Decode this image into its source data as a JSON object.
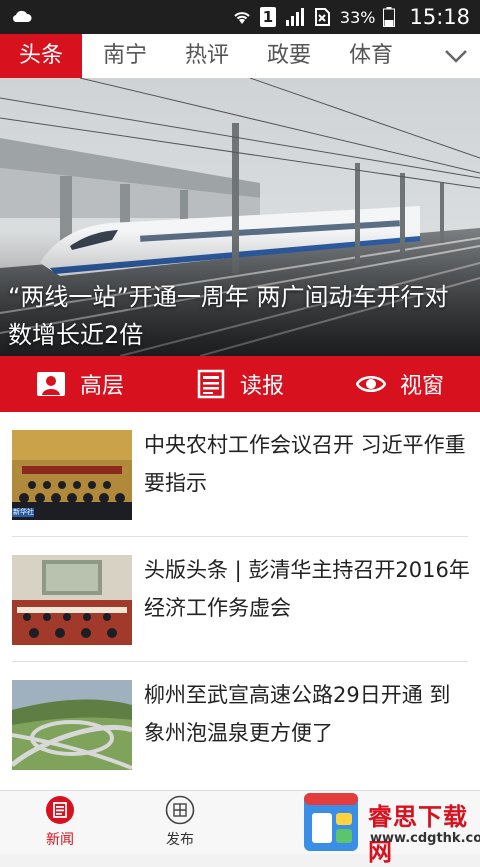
{
  "status_bar": {
    "battery_percent": "33%",
    "sim_slot": "1",
    "time": "15:18"
  },
  "tabs": [
    {
      "label": "头条",
      "active": true
    },
    {
      "label": "南宁",
      "active": false
    },
    {
      "label": "热评",
      "active": false
    },
    {
      "label": "政要",
      "active": false
    },
    {
      "label": "体育",
      "active": false
    }
  ],
  "hero": {
    "title": "“两线一站”开通一周年 两广间动车开行对数增长近2倍"
  },
  "quickbar": [
    {
      "label": "高层",
      "icon": "person-icon"
    },
    {
      "label": "读报",
      "icon": "newspaper-icon"
    },
    {
      "label": "视窗",
      "icon": "eye-icon"
    }
  ],
  "news": [
    {
      "title": "中央农村工作会议召开 习近平作重要指示",
      "thumb_caption": "新华社"
    },
    {
      "title": "头版头条 | 彭清华主持召开2016年经济工作务虚会"
    },
    {
      "title": "柳州至武宣高速公路29日开通 到象州泡温泉更方便了"
    }
  ],
  "bottom_nav": [
    {
      "label": "新闻",
      "active": true,
      "icon": "news-icon"
    },
    {
      "label": "发布",
      "active": false,
      "icon": "grid-circle-icon"
    }
  ],
  "watermark": {
    "text": "睿思下载网",
    "url": "www.cdgthk.com"
  },
  "colors": {
    "accent": "#d7111e",
    "status_bar": "#1f1f1f"
  }
}
